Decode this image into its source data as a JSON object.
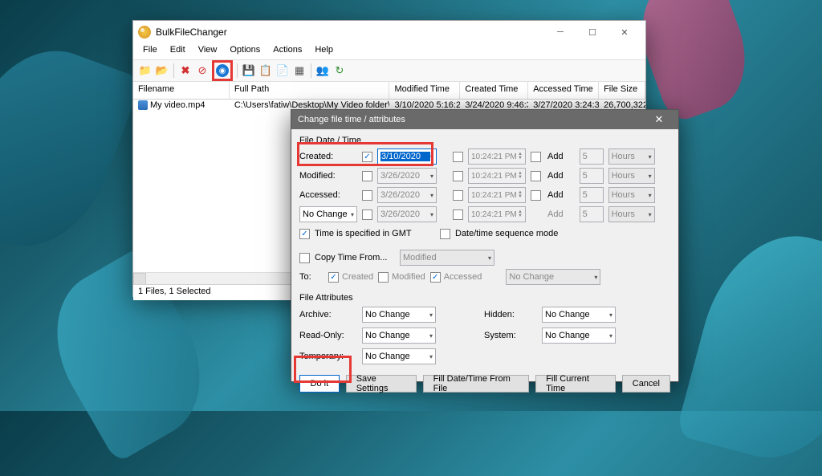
{
  "main_window": {
    "title": "BulkFileChanger",
    "menu": [
      "File",
      "Edit",
      "View",
      "Options",
      "Actions",
      "Help"
    ],
    "columns": {
      "filename": "Filename",
      "fullpath": "Full Path",
      "modified": "Modified Time",
      "created": "Created Time",
      "accessed": "Accessed Time",
      "filesize": "File Size"
    },
    "rows": [
      {
        "filename": "My video.mp4",
        "fullpath": "C:\\Users\\fatiw\\Desktop\\My Video folder\\M...",
        "modified": "3/10/2020 5:16:2...",
        "created": "3/24/2020 9:46:3...",
        "accessed": "3/27/2020 3:24:3...",
        "filesize": "26,700,322"
      }
    ],
    "status": "1 Files, 1 Selected"
  },
  "dialog": {
    "title": "Change file time / attributes",
    "group_datetime": "File Date / Time",
    "labels": {
      "created": "Created:",
      "modified": "Modified:",
      "accessed": "Accessed:",
      "add": "Add",
      "hours": "Hours",
      "gmt": "Time is specified in GMT",
      "sequence": "Date/time sequence mode",
      "copy_from": "Copy Time From...",
      "to": "To:",
      "to_created": "Created",
      "to_modified": "Modified",
      "to_accessed": "Accessed",
      "no_change": "No Change",
      "modified_opt": "Modified"
    },
    "values": {
      "created_date": "3/10/2020",
      "modified_date": "3/26/2020",
      "accessed_date": "3/26/2020",
      "nochange_date": "3/26/2020",
      "time": "10:24:21 PM",
      "add_num": "5"
    },
    "group_attrs": "File Attributes",
    "attrs": {
      "archive": "Archive:",
      "readonly": "Read-Only:",
      "temporary": "Temporary:",
      "hidden": "Hidden:",
      "system": "System:",
      "no_change": "No Change"
    },
    "buttons": {
      "doit": "Do it",
      "save": "Save Settings",
      "fill_file": "Fill Date/Time From File",
      "fill_current": "Fill Current Time",
      "cancel": "Cancel"
    }
  }
}
